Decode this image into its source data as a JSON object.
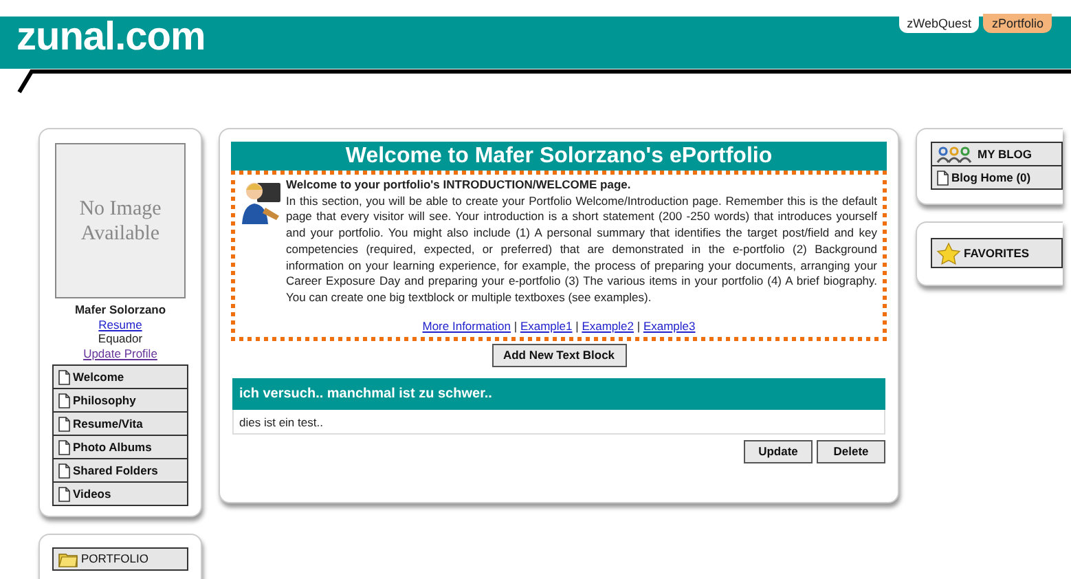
{
  "header": {
    "logo": "zunal.com",
    "tabs": [
      {
        "label": "zWebQuest",
        "selected": false
      },
      {
        "label": "zPortfolio",
        "selected": true
      }
    ]
  },
  "profile": {
    "photo_text": "No Image Available",
    "name": "Mafer Solorzano",
    "resume_link": "Resume",
    "country": "Equador",
    "update_link": "Update Profile"
  },
  "nav": [
    {
      "label": "Welcome"
    },
    {
      "label": "Philosophy"
    },
    {
      "label": "Resume/Vita"
    },
    {
      "label": "Photo Albums"
    },
    {
      "label": "Shared Folders"
    },
    {
      "label": "Videos"
    }
  ],
  "portfolio_box": {
    "label": "PORTFOLIO"
  },
  "main": {
    "title": "Welcome to Mafer Solorzano's ePortfolio",
    "intro_heading": "Welcome to your portfolio's INTRODUCTION/WELCOME page.",
    "intro_text": "In this section, you will be able to create your Portfolio Welcome/Introduction page. Remember this is the default page that every visitor will see. Your introduction is a short statement (200 -250 words) that introduces yourself and your portfolio. You might also include (1) A personal summary that identifies the target post/field and key competencies (required, expected, or preferred) that are demonstrated in the e-portfolio (2) Background information on your learning experience, for example, the process of preparing your documents, arranging your Career Exposure Day and preparing your e-portfolio (3) The various items in your portfolio (4) A brief biography. You can create one big textblock or multiple textboxes (see examples).",
    "links": [
      "More Information",
      "Example1",
      "Example2",
      "Example3"
    ],
    "separator": "|",
    "add_button": "Add New Text Block",
    "blocks": [
      {
        "title": "ich versuch.. manchmal ist zu schwer..",
        "body": "dies ist ein test..",
        "buttons": [
          "Update",
          "Delete"
        ]
      }
    ]
  },
  "blog": {
    "title": "MY BLOG",
    "items": [
      "Blog Home (0)"
    ]
  },
  "favorites": {
    "title": "FAVORITES"
  }
}
